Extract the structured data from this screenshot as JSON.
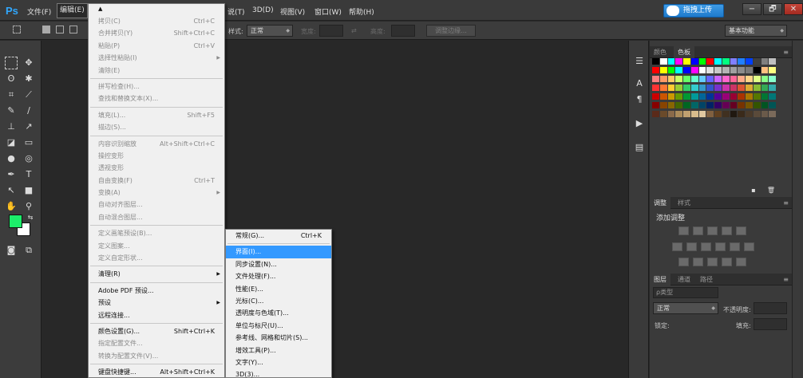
{
  "app": {
    "logo": "Ps",
    "menu": [
      "文件(F)",
      "编辑(E)",
      "说(T)",
      "3D(D)",
      "视图(V)",
      "窗口(W)",
      "帮助(H)"
    ],
    "upload_button": "拖拽上传",
    "window_controls": [
      "−",
      "🗗",
      "✕"
    ]
  },
  "options_bar": {
    "style_label": "样式:",
    "style_value": "正常",
    "width_label": "宽度:",
    "height_label": "高度:",
    "refine_edge": "调整边缘...",
    "workspace": "基本功能"
  },
  "colors": {
    "foreground": "#1cee6a",
    "background": "#ffffff",
    "highlight": "#3399ff"
  },
  "right_panels": {
    "swatches_tabs": [
      "颜色",
      "色板"
    ],
    "adjustments_tabs": [
      "调整",
      "样式"
    ],
    "adjustments_title": "添加调整",
    "layers_tabs": [
      "图层",
      "通道",
      "路径"
    ],
    "layers_filter": "ρ类型",
    "blend_mode": "正常",
    "opacity_label": "不透明度:",
    "lock_label": "锁定:",
    "fill_label": "填充:"
  },
  "edit_menu": [
    {
      "label": "拷贝(C)",
      "shortcut": "Ctrl+C",
      "disabled": true
    },
    {
      "label": "合并拷贝(Y)",
      "shortcut": "Shift+Ctrl+C",
      "disabled": true
    },
    {
      "label": "粘贴(P)",
      "shortcut": "Ctrl+V",
      "disabled": true
    },
    {
      "label": "选择性粘贴(I)",
      "submenu": true,
      "disabled": true
    },
    {
      "label": "清除(E)",
      "disabled": true
    },
    {
      "sep": true
    },
    {
      "label": "拼写检查(H)...",
      "disabled": true
    },
    {
      "label": "查找和替换文本(X)...",
      "disabled": true
    },
    {
      "sep": true
    },
    {
      "label": "填充(L)...",
      "shortcut": "Shift+F5",
      "disabled": true
    },
    {
      "label": "描边(S)...",
      "disabled": true
    },
    {
      "sep": true
    },
    {
      "label": "内容识别缩放",
      "shortcut": "Alt+Shift+Ctrl+C",
      "disabled": true
    },
    {
      "label": "操控变形",
      "disabled": true
    },
    {
      "label": "透视变形",
      "disabled": true
    },
    {
      "label": "自由变换(F)",
      "shortcut": "Ctrl+T",
      "disabled": true
    },
    {
      "label": "变换(A)",
      "submenu": true,
      "disabled": true
    },
    {
      "label": "自动对齐图层...",
      "disabled": true
    },
    {
      "label": "自动混合图层...",
      "disabled": true
    },
    {
      "sep": true
    },
    {
      "label": "定义画笔预设(B)...",
      "disabled": true
    },
    {
      "label": "定义图案...",
      "disabled": true
    },
    {
      "label": "定义自定形状...",
      "disabled": true
    },
    {
      "sep": true
    },
    {
      "label": "清理(R)",
      "submenu": true,
      "disabled": false
    },
    {
      "sep": true
    },
    {
      "label": "Adobe PDF 预设...",
      "disabled": false
    },
    {
      "label": "预设",
      "submenu": true,
      "disabled": false
    },
    {
      "label": "远程连接...",
      "disabled": false
    },
    {
      "sep": true
    },
    {
      "label": "颜色设置(G)...",
      "shortcut": "Shift+Ctrl+K",
      "disabled": false
    },
    {
      "label": "指定配置文件...",
      "disabled": true
    },
    {
      "label": "转换为配置文件(V)...",
      "disabled": true
    },
    {
      "sep": true
    },
    {
      "label": "键盘快捷键...",
      "shortcut": "Alt+Shift+Ctrl+K",
      "disabled": false
    }
  ],
  "preferences_menu": [
    {
      "label": "常规(G)...",
      "shortcut": "Ctrl+K",
      "highlight": false
    },
    {
      "sep": true
    },
    {
      "label": "界面(I)...",
      "highlight": true
    },
    {
      "label": "同步设置(N)...",
      "highlight": false
    },
    {
      "label": "文件处理(F)...",
      "highlight": false
    },
    {
      "label": "性能(E)...",
      "highlight": false
    },
    {
      "label": "光标(C)...",
      "highlight": false
    },
    {
      "label": "透明度与色域(T)...",
      "highlight": false
    },
    {
      "label": "单位与标尺(U)...",
      "highlight": false
    },
    {
      "label": "参考线、网格和切片(S)...",
      "highlight": false
    },
    {
      "label": "增效工具(P)...",
      "highlight": false
    },
    {
      "label": "文字(Y)...",
      "highlight": false
    },
    {
      "label": "3D(3)...",
      "highlight": false
    }
  ],
  "swatches": [
    "#000000",
    "#ffffff",
    "#00ffff",
    "#ff00ff",
    "#ffff00",
    "#0000ff",
    "#00ff00",
    "#ff0000",
    "#00ffff",
    "#00ff80",
    "#8080ff",
    "#2080ff",
    "#0040ff",
    "#404040",
    "#808080",
    "#c0c0c0",
    "#ff0000",
    "#ffff00",
    "#00ff00",
    "#00ffff",
    "#0000ff",
    "#ff00ff",
    "#ffffff",
    "#e0e0e0",
    "#c8c8c8",
    "#b4b4b4",
    "#a0a0a0",
    "#8c8c8c",
    "#787878",
    "#000000",
    "#ffc080",
    "#ffff80",
    "#ff8080",
    "#ff9966",
    "#ffcc66",
    "#ccff66",
    "#66ff66",
    "#66ffcc",
    "#66ccff",
    "#6666ff",
    "#cc66ff",
    "#ff66cc",
    "#ff6699",
    "#ffaa88",
    "#ffd488",
    "#e0ff88",
    "#88ff88",
    "#88ffcc",
    "#ff3333",
    "#ff7733",
    "#ffcc33",
    "#99cc33",
    "#33cc66",
    "#33cccc",
    "#3399cc",
    "#3355cc",
    "#7733cc",
    "#cc33aa",
    "#cc3366",
    "#dd5533",
    "#ddaa33",
    "#88bb33",
    "#33aa55",
    "#33aaaa",
    "#cc0000",
    "#cc5500",
    "#cc9900",
    "#669900",
    "#009933",
    "#009999",
    "#006699",
    "#003399",
    "#550099",
    "#990077",
    "#990033",
    "#aa3300",
    "#aa7700",
    "#557700",
    "#007733",
    "#007777",
    "#880000",
    "#884400",
    "#886600",
    "#446600",
    "#006622",
    "#006666",
    "#004466",
    "#002266",
    "#330066",
    "#660055",
    "#660022",
    "#773300",
    "#775500",
    "#335500",
    "#005522",
    "#005555",
    "#5a2a1a",
    "#6a4a2a",
    "#8a6a4a",
    "#aa8a5a",
    "#c0a070",
    "#d8bc8c",
    "#e0c8a0",
    "#806040",
    "#604020",
    "#403020",
    "#201810",
    "#3a2a1a",
    "#4a3a2a",
    "#5a4a3a",
    "#6a5a4a",
    "#7a6a5a"
  ]
}
